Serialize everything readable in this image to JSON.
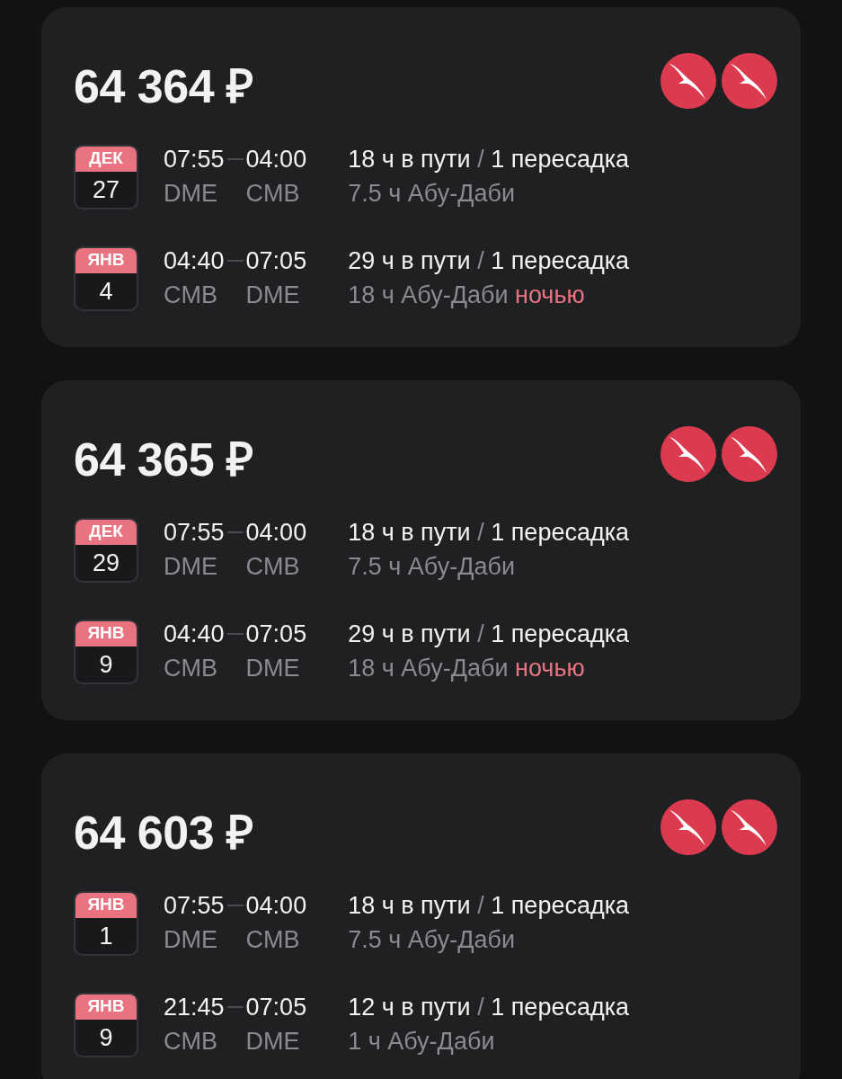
{
  "offers": [
    {
      "price": "64 364 ₽",
      "segments": [
        {
          "month": "ДЕК",
          "day": "27",
          "depart_time": "07:55",
          "arrive_time": "04:00",
          "from": "DME",
          "to": "CMB",
          "duration": "18 ч в пути",
          "separator": "/",
          "stops": "1 пересадка",
          "layover": "7.5 ч Абу-Даби"
        },
        {
          "month": "ЯНВ",
          "day": "4",
          "depart_time": "04:40",
          "arrive_time": "07:05",
          "from": "CMB",
          "to": "DME",
          "duration": "29 ч в пути",
          "separator": "/",
          "stops": "1 пересадка",
          "layover": "18 ч Абу-Даби",
          "note": "ночью"
        }
      ]
    },
    {
      "price": "64 365 ₽",
      "segments": [
        {
          "month": "ДЕК",
          "day": "29",
          "depart_time": "07:55",
          "arrive_time": "04:00",
          "from": "DME",
          "to": "CMB",
          "duration": "18 ч в пути",
          "separator": "/",
          "stops": "1 пересадка",
          "layover": "7.5 ч Абу-Даби"
        },
        {
          "month": "ЯНВ",
          "day": "9",
          "depart_time": "04:40",
          "arrive_time": "07:05",
          "from": "CMB",
          "to": "DME",
          "duration": "29 ч в пути",
          "separator": "/",
          "stops": "1 пересадка",
          "layover": "18 ч Абу-Даби",
          "note": "ночью"
        }
      ]
    },
    {
      "price": "64 603 ₽",
      "segments": [
        {
          "month": "ЯНВ",
          "day": "1",
          "depart_time": "07:55",
          "arrive_time": "04:00",
          "from": "DME",
          "to": "CMB",
          "duration": "18 ч в пути",
          "separator": "/",
          "stops": "1 пересадка",
          "layover": "7.5 ч Абу-Даби"
        },
        {
          "month": "ЯНВ",
          "day": "9",
          "depart_time": "21:45",
          "arrive_time": "07:05",
          "from": "CMB",
          "to": "DME",
          "duration": "12 ч в пути",
          "separator": "/",
          "stops": "1 пересадка",
          "layover": "1 ч Абу-Даби"
        }
      ]
    }
  ]
}
